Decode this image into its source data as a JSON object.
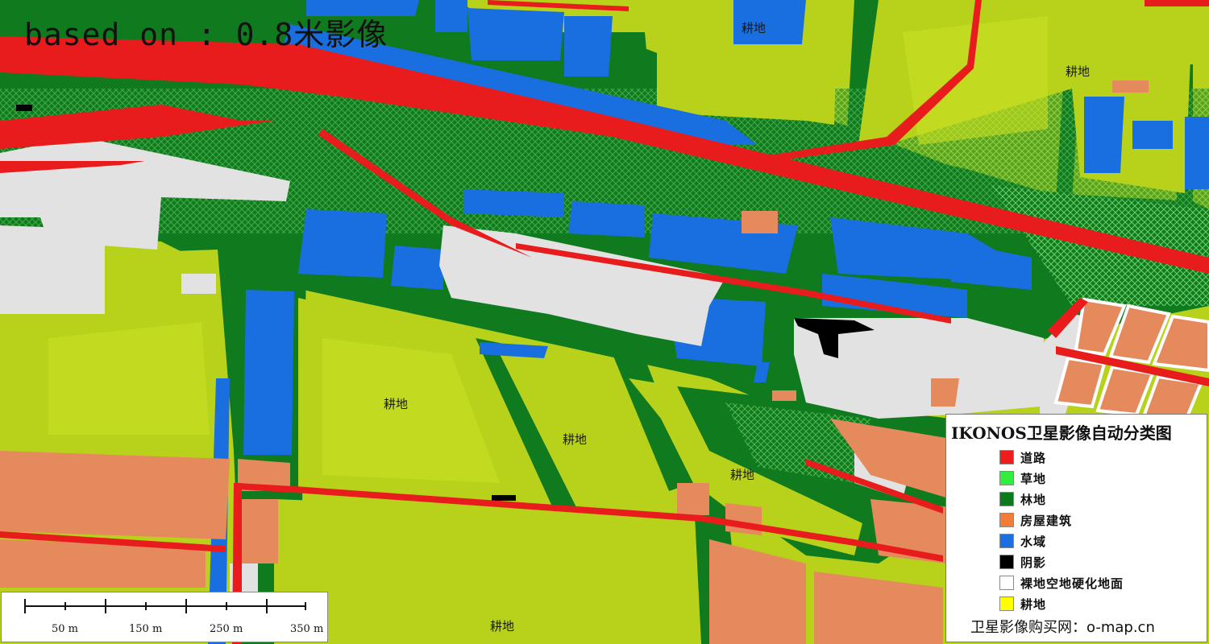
{
  "overlay_title": "based on : 0.8米影像",
  "map_labels": [
    "耕地",
    "耕地",
    "耕地",
    "耕地",
    "耕地",
    "耕地"
  ],
  "legend": {
    "title": "IKONOS卫星影像自动分类图",
    "items": [
      {
        "label": "道路",
        "color": "#ee1c1c"
      },
      {
        "label": "草地",
        "color": "#2ef03a"
      },
      {
        "label": "林地",
        "color": "#0a7a1a"
      },
      {
        "label": "房屋建筑",
        "color": "#f07e38"
      },
      {
        "label": "水域",
        "color": "#1c6fe0"
      },
      {
        "label": "阴影",
        "color": "#000000"
      },
      {
        "label": "裸地空地硬化地面",
        "color": "#ffffff"
      },
      {
        "label": "耕地",
        "color": "#ffff00"
      }
    ],
    "footer": "卫星影像购买网：o-map.cn"
  },
  "scale": {
    "labels": [
      "50 m",
      "150 m",
      "250 m",
      "350 m"
    ]
  },
  "colors": {
    "cropland": "#b8d21c",
    "forest": "#0f7a1e",
    "road": "#e81c1c",
    "water": "#1a6fe0",
    "building": "#e58a5c",
    "bare": "#e2e2e2",
    "shadow": "#000000"
  }
}
